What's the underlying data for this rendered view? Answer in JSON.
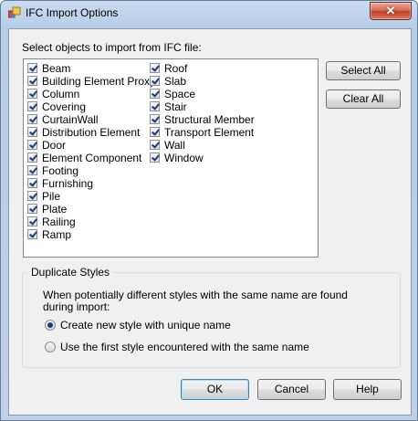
{
  "window": {
    "title": "IFC Import Options"
  },
  "select_label": "Select objects to import from IFC file:",
  "objects_col1": [
    "Beam",
    "Building Element Proxy",
    "Column",
    "Covering",
    "CurtainWall",
    "Distribution Element",
    "Door",
    "Element Component",
    "Footing",
    "Furnishing",
    "Pile",
    "Plate",
    "Railing",
    "Ramp"
  ],
  "objects_col2": [
    "Roof",
    "Slab",
    "Space",
    "Stair",
    "Structural Member",
    "Transport Element",
    "Wall",
    "Window"
  ],
  "buttons": {
    "select_all": "Select All",
    "clear_all": "Clear All",
    "ok": "OK",
    "cancel": "Cancel",
    "help": "Help"
  },
  "duplicate_styles": {
    "title": "Duplicate Styles",
    "description": "When potentially different styles with the same name are found during import:",
    "options": [
      {
        "label": "Create new style with unique name",
        "selected": true
      },
      {
        "label": "Use the first style encountered with the same name",
        "selected": false
      }
    ]
  },
  "icons": {
    "app": "ifc-app-icon",
    "close": "close-icon"
  }
}
